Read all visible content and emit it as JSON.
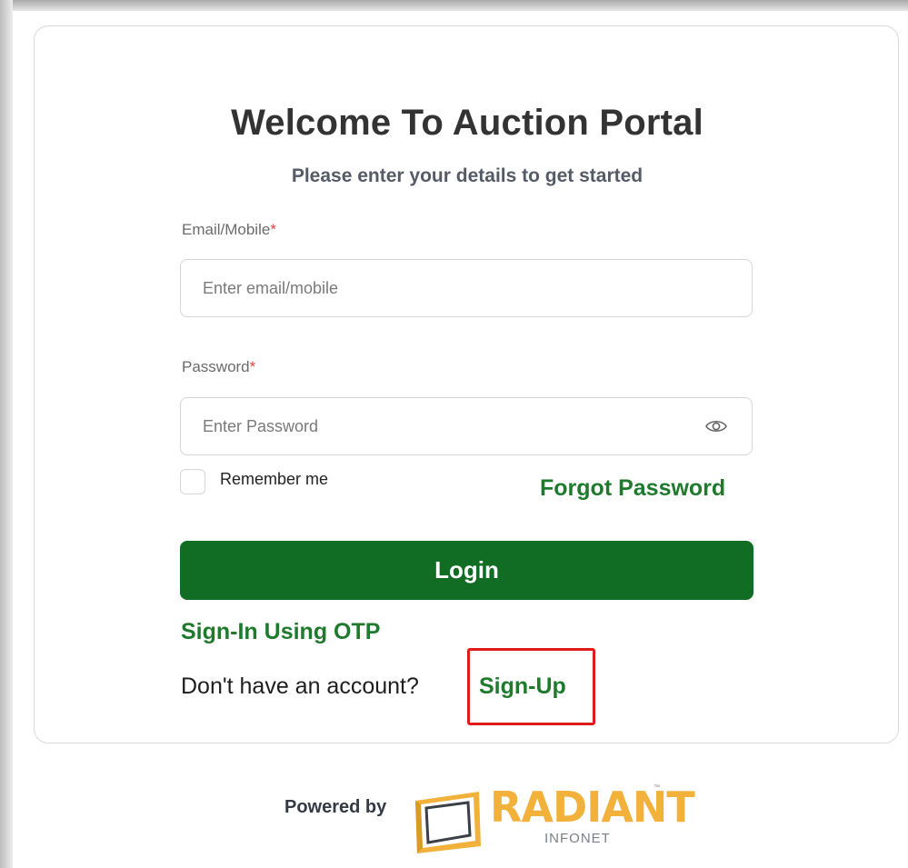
{
  "login": {
    "title": "Welcome To Auction Portal",
    "subtitle": "Please enter your details to get started",
    "email": {
      "label": "Email/Mobile",
      "required_mark": "*",
      "placeholder": "Enter email/mobile",
      "value": ""
    },
    "password": {
      "label": "Password",
      "required_mark": "*",
      "placeholder": "Enter Password",
      "value": "",
      "toggle_icon": "eye-icon"
    },
    "remember_me": {
      "label": "Remember me",
      "checked": false
    },
    "forgot_password_label": "Forgot Password",
    "login_label": "Login",
    "otp_label": "Sign-In Using OTP",
    "no_account_text": "Don't have an account?",
    "signup_label": "Sign-Up"
  },
  "footer": {
    "powered_by": "Powered by",
    "logo_text": "RADIANT",
    "logo_subtext": "INFONET",
    "logo_tm": "™"
  },
  "colors": {
    "primary_green": "#116d24",
    "link_green": "#1f7a2d",
    "required_red": "#e0443b",
    "highlight_red": "#e11a1a",
    "logo_gold": "#f2b13b"
  }
}
